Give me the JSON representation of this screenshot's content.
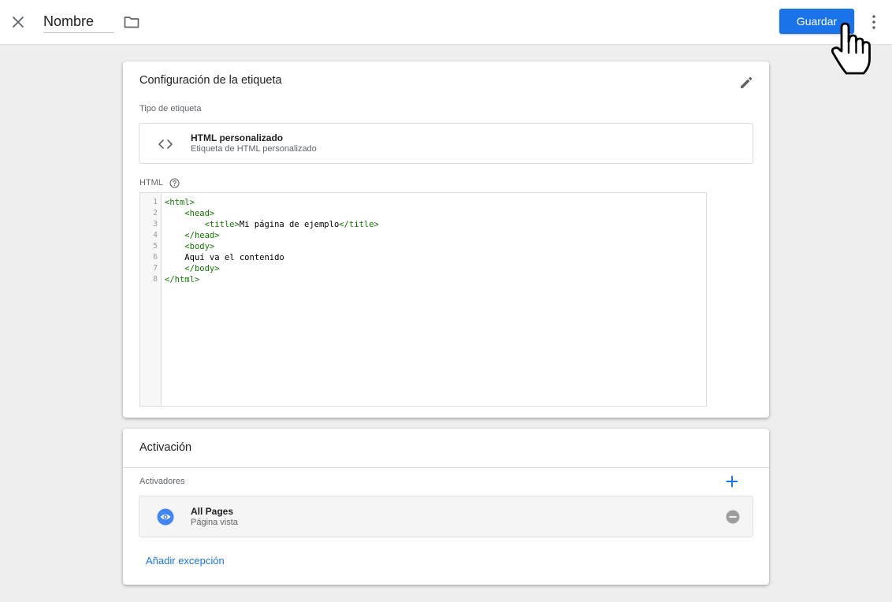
{
  "header": {
    "name_value": "Nombre",
    "save_label": "Guardar"
  },
  "tag_config": {
    "title": "Configuración de la etiqueta",
    "type_label": "Tipo de etiqueta",
    "type_name": "HTML personalizado",
    "type_description": "Etiqueta de HTML personalizado",
    "html_label": "HTML"
  },
  "code_editor": {
    "line_numbers": [
      "1",
      "2",
      "3",
      "4",
      "5",
      "6",
      "7",
      "8"
    ],
    "lines": [
      {
        "indent": "",
        "parts": [
          {
            "text": "<html>",
            "tag": true
          }
        ]
      },
      {
        "indent": "    ",
        "parts": [
          {
            "text": "<head>",
            "tag": true
          }
        ]
      },
      {
        "indent": "        ",
        "parts": [
          {
            "text": "<title>",
            "tag": true
          },
          {
            "text": "Mi página de ejemplo",
            "tag": false
          },
          {
            "text": "</title>",
            "tag": true
          }
        ]
      },
      {
        "indent": "    ",
        "parts": [
          {
            "text": "</head>",
            "tag": true
          }
        ]
      },
      {
        "indent": "    ",
        "parts": [
          {
            "text": "<body>",
            "tag": true
          }
        ]
      },
      {
        "indent": "    ",
        "parts": [
          {
            "text": "Aquí va el contenido",
            "tag": false
          }
        ]
      },
      {
        "indent": "    ",
        "parts": [
          {
            "text": "</body>",
            "tag": true
          }
        ]
      },
      {
        "indent": "",
        "parts": [
          {
            "text": "</html>",
            "tag": true
          }
        ]
      }
    ]
  },
  "triggering": {
    "title": "Activación",
    "triggers_label": "Activadores",
    "trigger_name": "All Pages",
    "trigger_type": "Página vista",
    "add_exception_label": "Añadir excepción"
  },
  "colors": {
    "accent": "#1a73e8",
    "code_tag": "#117700",
    "background": "#eeeeee"
  },
  "icons": [
    "close-icon",
    "folder-icon",
    "more-vert-icon",
    "pencil-icon",
    "code-icon",
    "help-icon",
    "plus-icon",
    "eye-icon",
    "remove-circle-icon",
    "hand-cursor-icon"
  ]
}
